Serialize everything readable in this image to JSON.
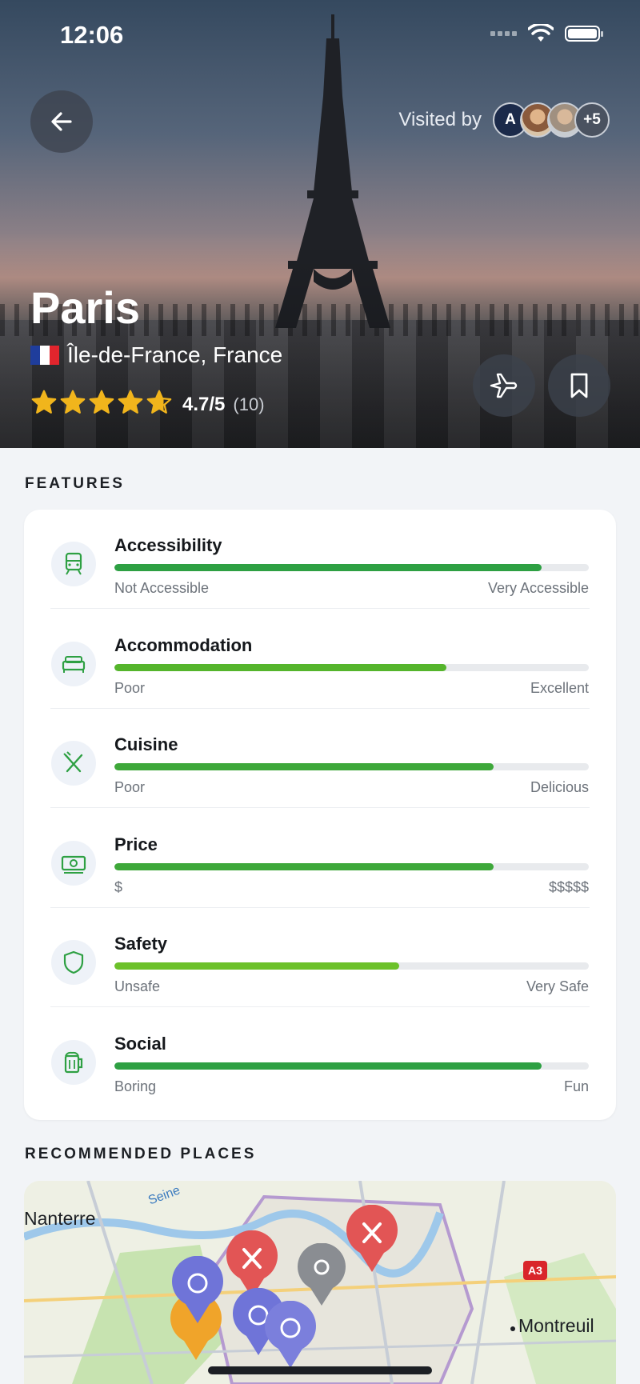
{
  "status": {
    "time": "12:06"
  },
  "header": {
    "visited_label": "Visited by",
    "avatars": [
      {
        "initial": "A",
        "kind": "initial"
      },
      {
        "initial": "",
        "kind": "photo"
      },
      {
        "initial": "",
        "kind": "photo"
      },
      {
        "initial": "+5",
        "kind": "more"
      }
    ]
  },
  "destination": {
    "name": "Paris",
    "location": "Île-de-France, France",
    "rating": "4.7/5",
    "rating_count": "(10)",
    "stars_value": 4.7
  },
  "features": {
    "section_title": "FEATURES",
    "items": [
      {
        "name": "Accessibility",
        "value": 0.9,
        "low": "Not Accessible",
        "high": "Very Accessible",
        "icon": "train-icon",
        "color": "#2ea043"
      },
      {
        "name": "Accommodation",
        "value": 0.7,
        "low": "Poor",
        "high": "Excellent",
        "icon": "bed-icon",
        "color": "#55b52c"
      },
      {
        "name": "Cuisine",
        "value": 0.8,
        "low": "Poor",
        "high": "Delicious",
        "icon": "fork-knife-icon",
        "color": "#3ea83a"
      },
      {
        "name": "Price",
        "value": 0.8,
        "low": "$",
        "high": "$$$$$",
        "icon": "money-icon",
        "color": "#3ea83a"
      },
      {
        "name": "Safety",
        "value": 0.6,
        "low": "Unsafe",
        "high": "Very Safe",
        "icon": "shield-icon",
        "color": "#6cc12a"
      },
      {
        "name": "Social",
        "value": 0.9,
        "low": "Boring",
        "high": "Fun",
        "icon": "beer-icon",
        "color": "#2ea043"
      }
    ]
  },
  "recommended": {
    "section_title": "RECOMMENDED PLACES",
    "map_labels": {
      "nanterre": "Nanterre",
      "montreuil": "Montreuil",
      "seine": "Seine",
      "a3": "A3"
    }
  }
}
